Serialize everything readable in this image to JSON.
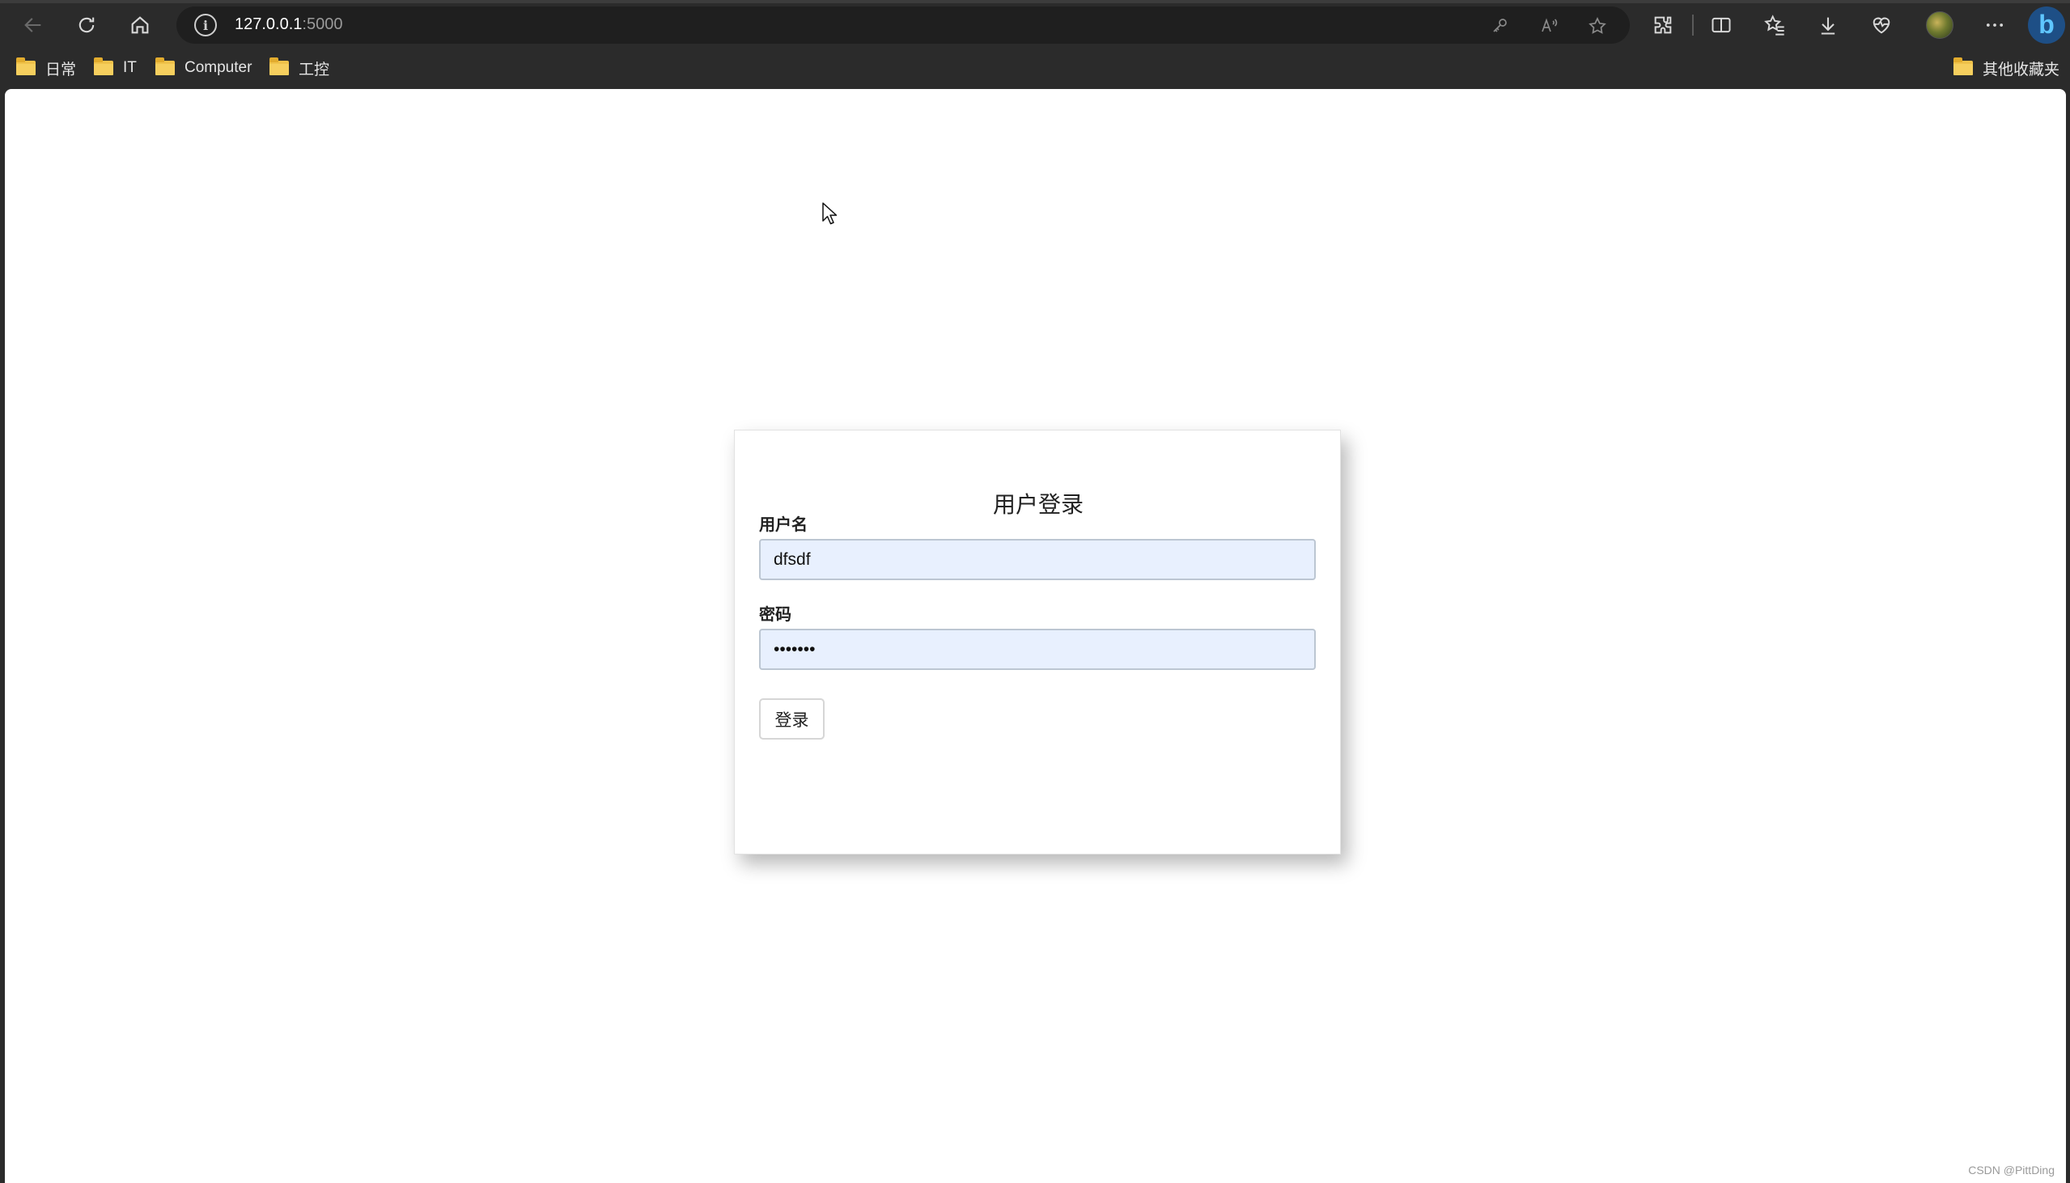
{
  "browser": {
    "url_host": "127.0.0.1",
    "url_port": ":5000",
    "accent_color": "#1e4f86",
    "toolbar_icons": [
      "back-icon",
      "refresh-icon",
      "home-icon",
      "key-icon",
      "read-aloud-icon",
      "favorite-star-icon",
      "extensions-icon",
      "split-screen-icon",
      "favorites-icon",
      "downloads-icon",
      "browser-essentials-icon",
      "profile-avatar",
      "more-icon",
      "copilot-icon"
    ]
  },
  "favorites": {
    "items": [
      {
        "label": "日常"
      },
      {
        "label": "IT"
      },
      {
        "label": "Computer"
      },
      {
        "label": "工控"
      }
    ],
    "other_label": "其他收藏夹"
  },
  "login": {
    "title": "用户登录",
    "username_label": "用户名",
    "username_value": "dfsdf",
    "password_label": "密码",
    "password_value": "•••••••",
    "submit_label": "登录",
    "input_fill_color": "#e8f0fe"
  },
  "watermark": "CSDN @PittDing"
}
